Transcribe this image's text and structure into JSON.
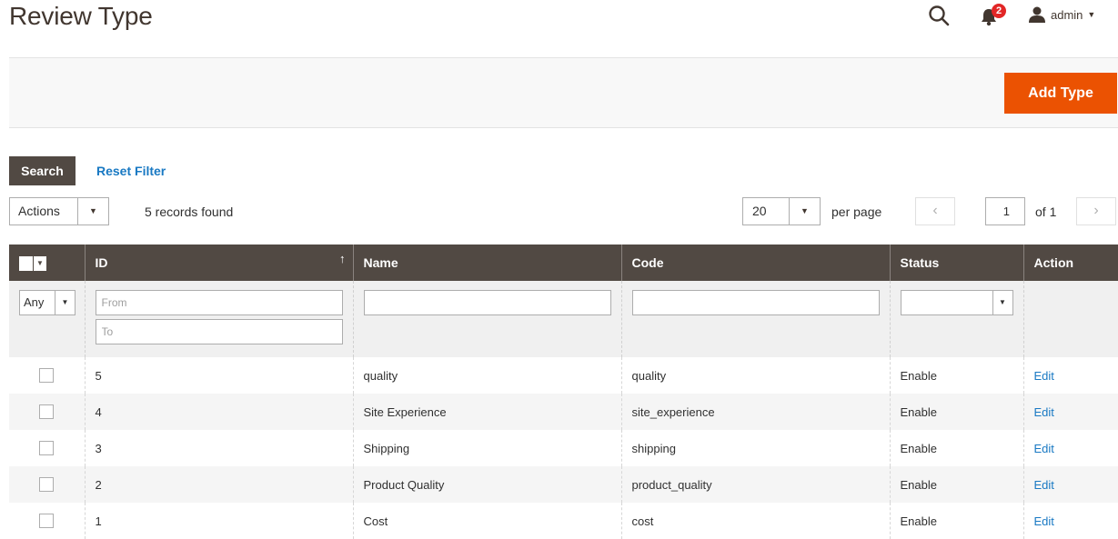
{
  "page": {
    "title": "Review Type"
  },
  "header": {
    "notifications_count": "2",
    "user": "admin"
  },
  "toolbar": {
    "add_label": "Add Type"
  },
  "filters": {
    "search_label": "Search",
    "reset_label": "Reset Filter",
    "actions_label": "Actions",
    "records_text": "5 records found",
    "per_page_value": "20",
    "per_page_label": "per page",
    "page_value": "1",
    "page_of": "of 1"
  },
  "grid": {
    "columns": [
      "ID",
      "Name",
      "Code",
      "Status",
      "Action"
    ],
    "filter": {
      "any_label": "Any",
      "from_placeholder": "From",
      "to_placeholder": "To"
    },
    "rows": [
      {
        "id": "5",
        "name": "quality",
        "code": "quality",
        "status": "Enable",
        "action": "Edit"
      },
      {
        "id": "4",
        "name": "Site Experience",
        "code": "site_experience",
        "status": "Enable",
        "action": "Edit"
      },
      {
        "id": "3",
        "name": "Shipping",
        "code": "shipping",
        "status": "Enable",
        "action": "Edit"
      },
      {
        "id": "2",
        "name": "Product Quality",
        "code": "product_quality",
        "status": "Enable",
        "action": "Edit"
      },
      {
        "id": "1",
        "name": "Cost",
        "code": "cost",
        "status": "Enable",
        "action": "Edit"
      }
    ]
  },
  "colors": {
    "accent": "#eb5202",
    "header_bg": "#514943",
    "link": "#1979c3"
  }
}
